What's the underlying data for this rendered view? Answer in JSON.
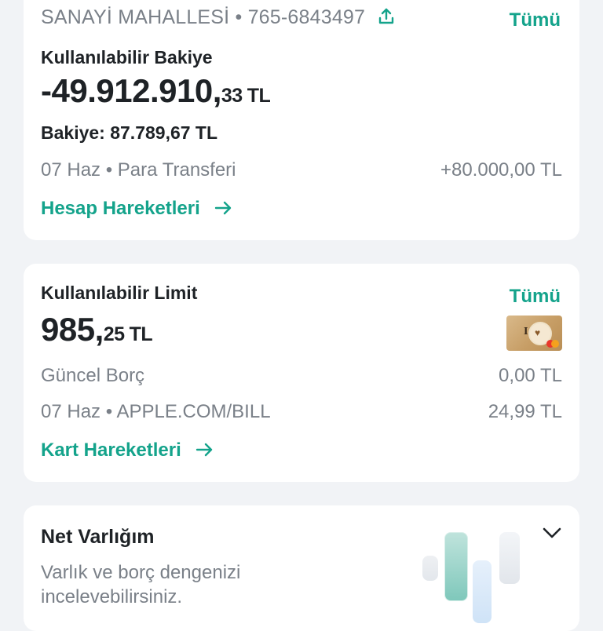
{
  "account": {
    "branch_line": "SANAYİ MAHALLESİ • 765-6843497",
    "all_link": "Tümü",
    "available_balance_label": "Kullanılabilir Bakiye",
    "available_balance_main": "-49.912.910,",
    "available_balance_decimals": "33",
    "available_balance_currency": "TL",
    "balance_line": "Bakiye: 87.789,67 TL",
    "last_transaction_desc": "07 Haz • Para Transferi",
    "last_transaction_amount": "+80.000,00 TL",
    "movements_link": "Hesap Hareketleri",
    "icons": [
      "share-icon",
      "arrow-right-icon"
    ]
  },
  "credit_card": {
    "available_limit_label": "Kullanılabilir Limit",
    "all_link": "Tümü",
    "available_limit_main": "985,",
    "available_limit_decimals": "25",
    "available_limit_currency": "TL",
    "current_debt_label": "Güncel Borç",
    "current_debt_amount": "0,00 TL",
    "last_transaction_desc": "07 Haz • APPLE.COM/BILL",
    "last_transaction_amount": "24,99 TL",
    "movements_link": "Kart Hareketleri",
    "icons": [
      "card-thumbnail",
      "arrow-right-icon"
    ]
  },
  "net_worth": {
    "title": "Net Varlığım",
    "subtitle": "Varlık ve borç dengenizi incelevebilirsiniz.",
    "icons": [
      "chevron-down-icon",
      "bar-illustration"
    ]
  },
  "colors": {
    "accent": "#14a38b",
    "text_dark": "#1e2226",
    "text_gray": "#7a8088",
    "background": "#f1f3f6",
    "card": "#ffffff"
  }
}
